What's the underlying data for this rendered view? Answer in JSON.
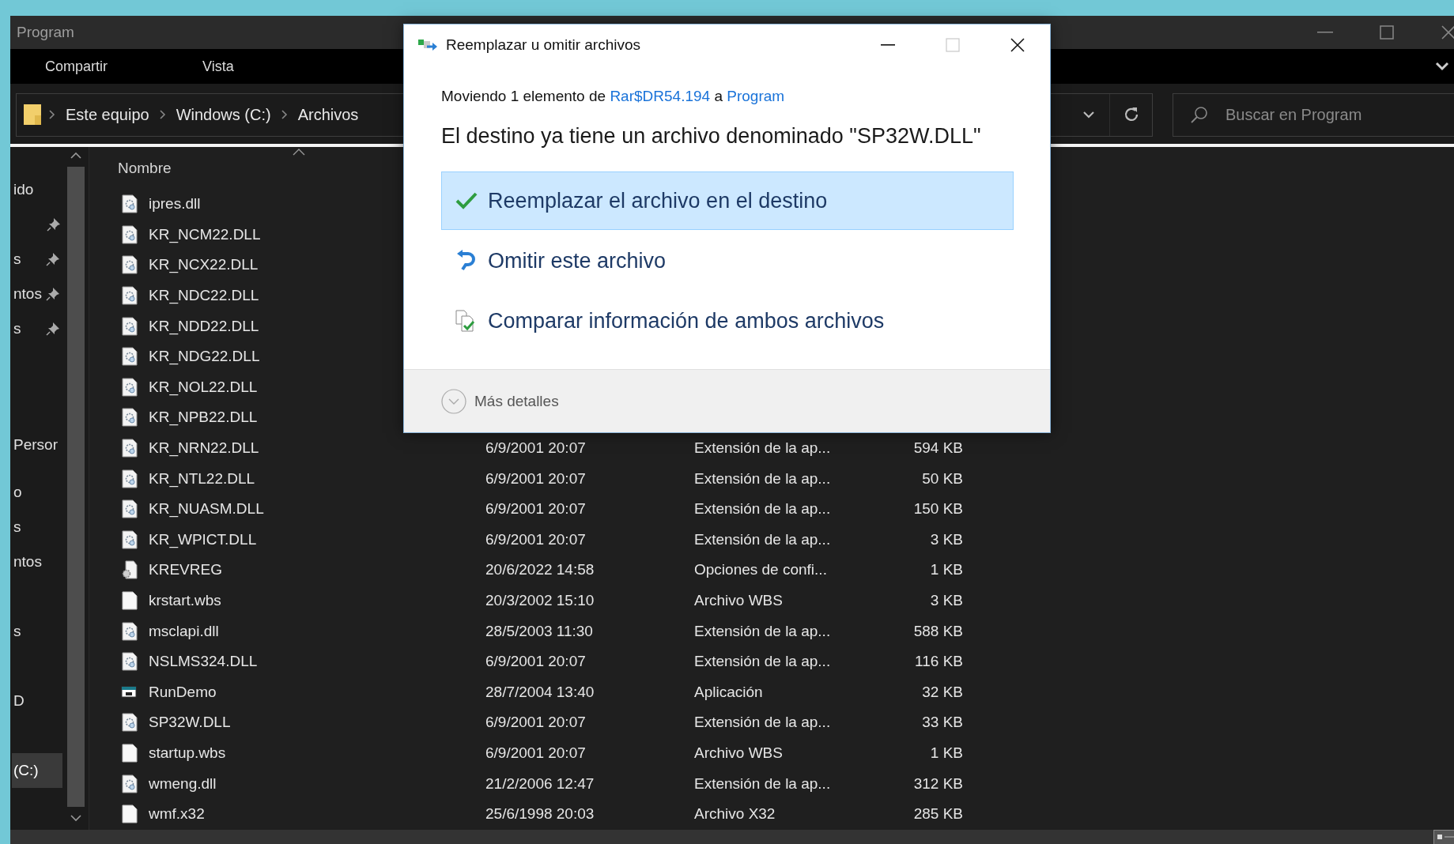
{
  "explorer": {
    "title": "Program",
    "window_controls": {
      "maximize_disabled": false
    },
    "ribbon_tabs": [
      "Compartir",
      "Vista"
    ],
    "breadcrumbs": [
      "Este equipo",
      "Windows (C:)",
      "Archivos"
    ],
    "search": {
      "placeholder": "Buscar en Program"
    },
    "nav_pane": {
      "sections": [
        [
          {
            "label": "ido",
            "pinned": false,
            "selected": false
          },
          {
            "pinned": true,
            "selected": false
          },
          {
            "label": "s",
            "pinned": true,
            "selected": false
          },
          {
            "label": "ntos",
            "pinned": true,
            "selected": false
          },
          {
            "label": "s",
            "pinned": true,
            "selected": false
          }
        ],
        [
          {
            "label": "Persor",
            "pinned": false,
            "selected": false
          }
        ],
        [
          {
            "label": "o",
            "pinned": false,
            "selected": false
          },
          {
            "label": "s",
            "pinned": false,
            "selected": false
          },
          {
            "label": "ntos",
            "pinned": false,
            "selected": false
          }
        ],
        [
          {
            "label": "s",
            "pinned": false,
            "selected": false
          }
        ],
        [
          {
            "label": "D",
            "pinned": false,
            "selected": false
          }
        ],
        [
          {
            "label": "(C:)",
            "pinned": false,
            "selected": true
          }
        ]
      ]
    },
    "file_list": {
      "columns": [
        "Nombre"
      ],
      "rows": [
        {
          "name": "ipres.dll",
          "kind": "dll"
        },
        {
          "name": "KR_NCM22.DLL",
          "kind": "dll"
        },
        {
          "name": "KR_NCX22.DLL",
          "kind": "dll"
        },
        {
          "name": "KR_NDC22.DLL",
          "kind": "dll"
        },
        {
          "name": "KR_NDD22.DLL",
          "kind": "dll"
        },
        {
          "name": "KR_NDG22.DLL",
          "kind": "dll"
        },
        {
          "name": "KR_NOL22.DLL",
          "kind": "dll"
        },
        {
          "name": "KR_NPB22.DLL",
          "kind": "dll"
        },
        {
          "name": "KR_NRN22.DLL",
          "kind": "dll",
          "date": "6/9/2001 20:07",
          "type": "Extensión de la ap...",
          "size": "594 KB"
        },
        {
          "name": "KR_NTL22.DLL",
          "kind": "dll",
          "date": "6/9/2001 20:07",
          "type": "Extensión de la ap...",
          "size": "50 KB"
        },
        {
          "name": "KR_NUASM.DLL",
          "kind": "dll",
          "date": "6/9/2001 20:07",
          "type": "Extensión de la ap...",
          "size": "150 KB"
        },
        {
          "name": "KR_WPICT.DLL",
          "kind": "dll",
          "date": "6/9/2001 20:07",
          "type": "Extensión de la ap...",
          "size": "3 KB"
        },
        {
          "name": "KREVREG",
          "kind": "config",
          "date": "20/6/2022 14:58",
          "type": "Opciones de confi...",
          "size": "1 KB"
        },
        {
          "name": "krstart.wbs",
          "kind": "blank",
          "date": "20/3/2002 15:10",
          "type": "Archivo WBS",
          "size": "3 KB"
        },
        {
          "name": "msclapi.dll",
          "kind": "dll",
          "date": "28/5/2003 11:30",
          "type": "Extensión de la ap...",
          "size": "588 KB"
        },
        {
          "name": "NSLMS324.DLL",
          "kind": "dll",
          "date": "6/9/2001 20:07",
          "type": "Extensión de la ap...",
          "size": "116 KB"
        },
        {
          "name": "RunDemo",
          "kind": "app",
          "date": "28/7/2004 13:40",
          "type": "Aplicación",
          "size": "32 KB"
        },
        {
          "name": "SP32W.DLL",
          "kind": "dll",
          "date": "6/9/2001 20:07",
          "type": "Extensión de la ap...",
          "size": "33 KB"
        },
        {
          "name": "startup.wbs",
          "kind": "blank",
          "date": "6/9/2001 20:07",
          "type": "Archivo WBS",
          "size": "1 KB"
        },
        {
          "name": "wmeng.dll",
          "kind": "dll",
          "date": "21/2/2006 12:47",
          "type": "Extensión de la ap...",
          "size": "312 KB"
        },
        {
          "name": "wmf.x32",
          "kind": "blank",
          "date": "25/6/1998 20:03",
          "type": "Archivo X32",
          "size": "285 KB"
        }
      ]
    }
  },
  "dialog": {
    "title": "Reemplazar u omitir archivos",
    "maximize_disabled": true,
    "move_text": {
      "before": "Moviendo 1 elemento de",
      "source": "Rar$DR54.194",
      "joiner": "a",
      "destination": "Program"
    },
    "heading": "El destino ya tiene un archivo denominado \"SP32W.DLL\"",
    "options": [
      {
        "kind": "replace",
        "label": "Reemplazar el archivo en el destino",
        "selected": true
      },
      {
        "kind": "skip",
        "label": "Omitir este archivo",
        "selected": false
      },
      {
        "kind": "compare",
        "label": "Comparar información de ambos archivos",
        "selected": false
      }
    ],
    "details": {
      "label": "Más detalles",
      "expanded": false
    }
  }
}
